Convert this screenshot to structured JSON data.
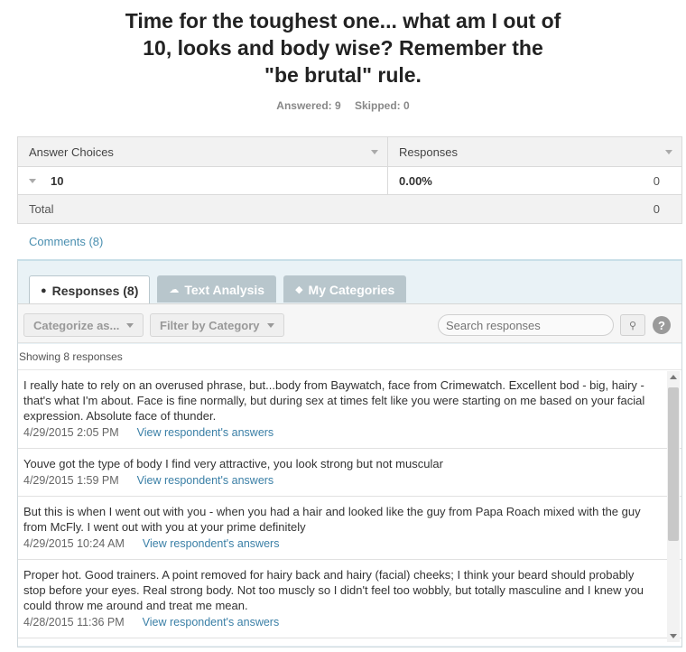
{
  "question": {
    "title_lines": [
      "Time for the toughest one... what am I out of",
      "10, looks and body wise? Remember the",
      "\"be brutal\" rule."
    ],
    "answered": "Answered: 9",
    "skipped": "Skipped: 0"
  },
  "table": {
    "header": {
      "col1": "Answer Choices",
      "col2": "Responses"
    },
    "rows": [
      {
        "choice": "10",
        "percent": "0.00%",
        "count": "0"
      }
    ],
    "total": {
      "label": "Total",
      "count": "0"
    }
  },
  "comments_link": "Comments (8)",
  "tabs": [
    {
      "label": "Responses (8)",
      "icon": "speech-bubble-icon",
      "active": true
    },
    {
      "label": "Text Analysis",
      "icon": "cloud-icon",
      "active": false
    },
    {
      "label": "My Categories",
      "icon": "tag-icon",
      "active": false
    }
  ],
  "toolbar": {
    "categorize": "Categorize as...",
    "filter": "Filter by Category",
    "search_placeholder": "Search responses",
    "help": "?"
  },
  "showing": "Showing 8 responses",
  "responses": [
    {
      "text": "I really hate to rely on an overused phrase, but...body from Baywatch, face from Crimewatch. Excellent bod - big, hairy - that's what I'm about. Face is fine normally, but during sex at times felt like you were starting on me based on your facial expression. Absolute face of thunder.",
      "date": "4/29/2015 2:05 PM",
      "link": "View respondent's answers"
    },
    {
      "text": "Youve got the type of body I find very attractive, you look strong but not muscular",
      "date": "4/29/2015 1:59 PM",
      "link": "View respondent's answers"
    },
    {
      "text": "But this is when I went out with you - when you had a hair and looked like the guy from Papa Roach mixed with the guy from McFly. I went out with you at your prime definitely",
      "date": "4/29/2015 10:24 AM",
      "link": "View respondent's answers"
    },
    {
      "text": "Proper hot. Good trainers. A point removed for hairy back and hairy (facial) cheeks; I think your beard should probably stop before your eyes. Real strong body. Not too muscly so I didn't feel too wobbly, but totally masculine and I knew you could throw me around and treat me mean.",
      "date": "4/28/2015 11:36 PM",
      "link": "View respondent's answers"
    }
  ]
}
